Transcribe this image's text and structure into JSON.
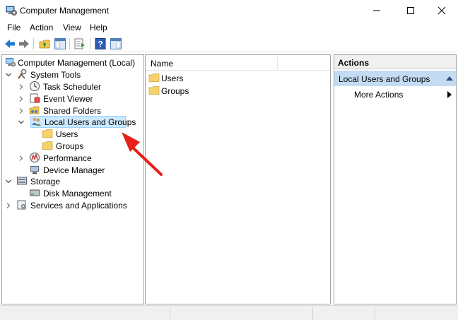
{
  "window": {
    "title": "Computer Management"
  },
  "menu": [
    "File",
    "Action",
    "View",
    "Help"
  ],
  "tree": [
    {
      "label": "Computer Management (Local)"
    },
    {
      "label": "System Tools"
    },
    {
      "label": "Task Scheduler"
    },
    {
      "label": "Event Viewer"
    },
    {
      "label": "Shared Folders"
    },
    {
      "label": "Local Users and Groups",
      "selected": true
    },
    {
      "label": "Users"
    },
    {
      "label": "Groups"
    },
    {
      "label": "Performance"
    },
    {
      "label": "Device Manager"
    },
    {
      "label": "Storage"
    },
    {
      "label": "Disk Management"
    },
    {
      "label": "Services and Applications"
    }
  ],
  "list": {
    "column_name": "Name",
    "items": [
      "Users",
      "Groups"
    ]
  },
  "actions": {
    "header": "Actions",
    "section": "Local Users and Groups",
    "more": "More Actions"
  },
  "colors": {
    "selection": "#cce8ff",
    "actions_section": "#c4dcf3",
    "annotation_arrow": "#e8201a"
  }
}
